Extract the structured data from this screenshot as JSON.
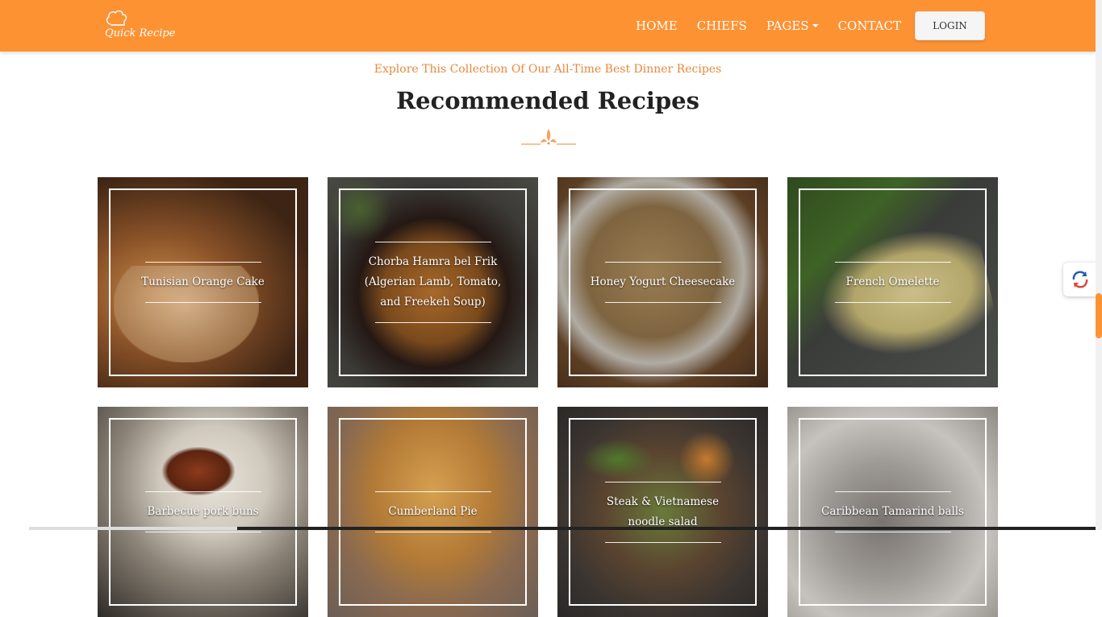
{
  "brand": {
    "name": "Quick Recipe"
  },
  "nav": {
    "items": [
      {
        "label": "HOME"
      },
      {
        "label": "CHIEFS"
      },
      {
        "label": "PAGES"
      },
      {
        "label": "CONTACT"
      }
    ],
    "login_label": "LOGIN"
  },
  "section": {
    "subtitle": "Explore This Collection Of Our All-Time Best Dinner Recipes",
    "title": "Recommended Recipes"
  },
  "recipes": [
    {
      "title": "Tunisian Orange Cake"
    },
    {
      "title": "Chorba Hamra bel Frik (Algerian Lamb, Tomato, and Freekeh Soup)"
    },
    {
      "title": "Honey Yogurt Cheesecake"
    },
    {
      "title": "French Omelette"
    },
    {
      "title": "Barbecue pork buns"
    },
    {
      "title": "Cumberland Pie"
    },
    {
      "title": "Steak & Vietnamese noodle salad"
    },
    {
      "title": "Caribbean Tamarind balls"
    }
  ],
  "colors": {
    "accent": "#fd9233",
    "subtitle": "#e8893a",
    "heading": "#222222"
  },
  "icons": {
    "logo": "chef-hat-icon",
    "widget": "chat-refresh-icon"
  }
}
